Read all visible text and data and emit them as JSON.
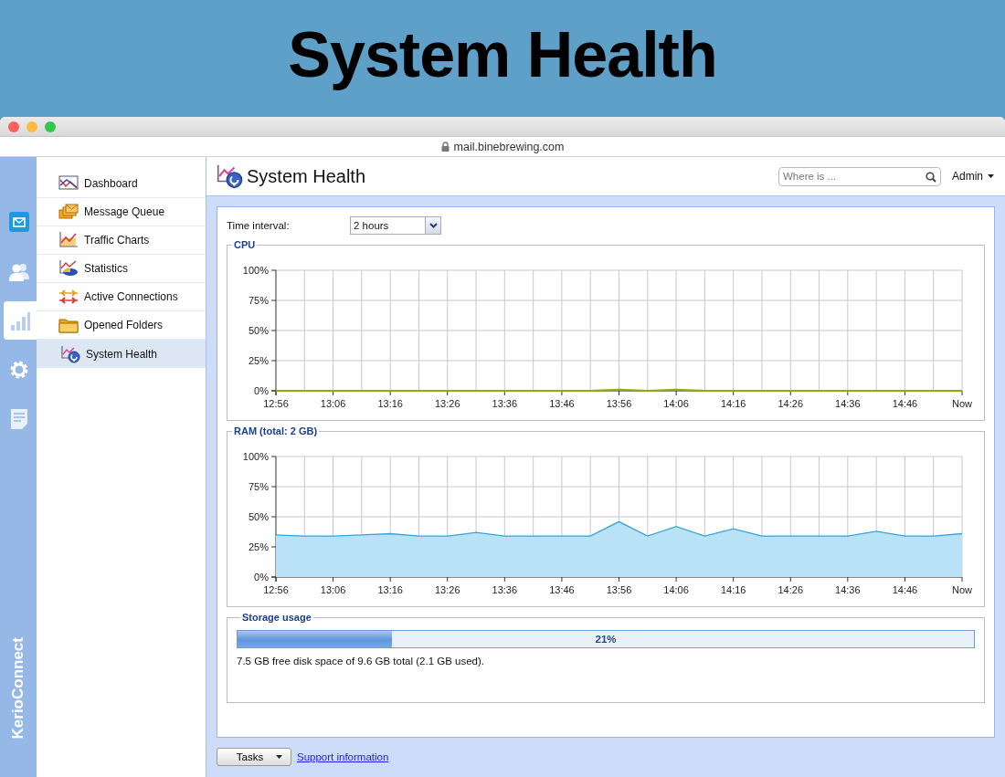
{
  "banner": {
    "title": "System Health"
  },
  "browser": {
    "url": "mail.binebrewing.com"
  },
  "rail": {
    "items": [
      {
        "kind": "mail",
        "selected": false
      },
      {
        "kind": "users",
        "selected": false
      },
      {
        "kind": "charts",
        "selected": true
      },
      {
        "kind": "settings",
        "selected": false
      },
      {
        "kind": "notes",
        "selected": false
      }
    ],
    "brand": "KerioConnect"
  },
  "nav": {
    "items": [
      {
        "label": "Dashboard",
        "kind": "dashboard",
        "selected": false
      },
      {
        "label": "Message Queue",
        "kind": "queue",
        "selected": false
      },
      {
        "label": "Traffic Charts",
        "kind": "traffic",
        "selected": false
      },
      {
        "label": "Statistics",
        "kind": "statistics",
        "selected": false
      },
      {
        "label": "Active Connections",
        "kind": "connections",
        "selected": false
      },
      {
        "label": "Opened Folders",
        "kind": "folders",
        "selected": false
      },
      {
        "label": "System Health",
        "kind": "health",
        "selected": true
      }
    ]
  },
  "header": {
    "title": "System Health",
    "search": {
      "placeholder": "Where is ..."
    },
    "user": "Admin"
  },
  "time_interval": {
    "label": "Time interval:",
    "value": "2 hours"
  },
  "cpu": {
    "title": "CPU",
    "chart_data": {
      "type": "line",
      "grid": true,
      "categories": [
        "12:56",
        null,
        "13:06",
        null,
        "13:16",
        null,
        "13:26",
        null,
        "13:36",
        null,
        "13:46",
        null,
        "13:56",
        null,
        "14:06",
        null,
        "14:16",
        null,
        "14:26",
        null,
        "14:36",
        null,
        "14:46",
        null,
        "Now"
      ],
      "ylim": [
        0,
        100
      ],
      "yticks": [
        {
          "value": 0,
          "label": "0%"
        },
        {
          "value": 25,
          "label": "25%"
        },
        {
          "value": 50,
          "label": "50%"
        },
        {
          "value": 75,
          "label": "75%"
        },
        {
          "value": 100,
          "label": "100%"
        }
      ],
      "series": [
        {
          "color": "#8fae00",
          "values": [
            0,
            0,
            0,
            0,
            0,
            0,
            0,
            0,
            0,
            0,
            0,
            0,
            1,
            0,
            1,
            0,
            0,
            0,
            0,
            0,
            0,
            0,
            0,
            0,
            0
          ]
        }
      ]
    }
  },
  "ram": {
    "title": "RAM (total: 2 GB)",
    "chart_data": {
      "type": "area",
      "grid": true,
      "categories": [
        "12:56",
        null,
        "13:06",
        null,
        "13:16",
        null,
        "13:26",
        null,
        "13:36",
        null,
        "13:46",
        null,
        "13:56",
        null,
        "14:06",
        null,
        "14:16",
        null,
        "14:26",
        null,
        "14:36",
        null,
        "14:46",
        null,
        "Now"
      ],
      "ylim": [
        0,
        100
      ],
      "yticks": [
        {
          "value": 0,
          "label": "0%"
        },
        {
          "value": 25,
          "label": "25%"
        },
        {
          "value": 50,
          "label": "50%"
        },
        {
          "value": 75,
          "label": "75%"
        },
        {
          "value": 100,
          "label": "100%"
        }
      ],
      "series": [
        {
          "color": "#35a4dc",
          "values": [
            35,
            34,
            34,
            35,
            36,
            34,
            34,
            37,
            34,
            34,
            34,
            34,
            46,
            34,
            42,
            34,
            40,
            34,
            34,
            34,
            34,
            38,
            34,
            34,
            36
          ]
        }
      ]
    }
  },
  "storage": {
    "title": "Storage usage",
    "level": 0.21,
    "reading": "21%",
    "note": "7.5 GB free disk space of 9.6 GB total (2.1 GB used)."
  },
  "footer": {
    "tasks": "Tasks",
    "link": "Support information"
  }
}
